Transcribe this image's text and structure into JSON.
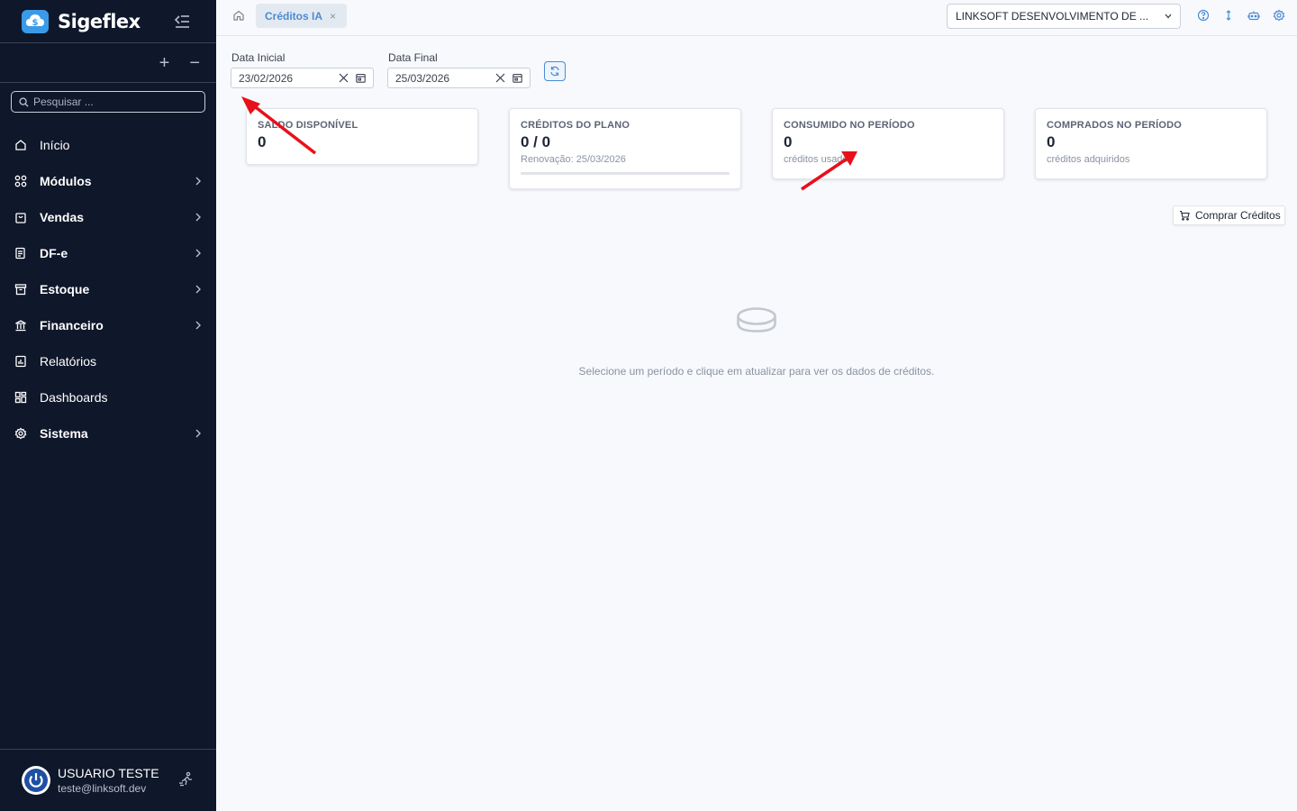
{
  "app": {
    "brand": "Sigeflex"
  },
  "sidebar": {
    "search_placeholder": "Pesquisar ...",
    "items": [
      {
        "label": "Início",
        "icon": "home-icon",
        "bold": false,
        "chevron": false
      },
      {
        "label": "Módulos",
        "icon": "grid-icon",
        "bold": true,
        "chevron": true
      },
      {
        "label": "Vendas",
        "icon": "shopping-bag-icon",
        "bold": true,
        "chevron": true
      },
      {
        "label": "DF-e",
        "icon": "document-icon",
        "bold": true,
        "chevron": true
      },
      {
        "label": "Estoque",
        "icon": "archive-box-icon",
        "bold": true,
        "chevron": true
      },
      {
        "label": "Financeiro",
        "icon": "bank-icon",
        "bold": true,
        "chevron": true
      },
      {
        "label": "Relatórios",
        "icon": "report-icon",
        "bold": false,
        "chevron": false
      },
      {
        "label": "Dashboards",
        "icon": "dashboard-icon",
        "bold": false,
        "chevron": false
      },
      {
        "label": "Sistema",
        "icon": "gear-icon",
        "bold": true,
        "chevron": true
      }
    ],
    "user": {
      "name": "USUARIO TESTE",
      "email": "teste@linksoft.dev"
    }
  },
  "topbar": {
    "tab_label": "Créditos IA",
    "tab_close": "×",
    "company": "LINKSOFT DESENVOLVIMENTO DE ..."
  },
  "filters": {
    "start_label": "Data Inicial",
    "start_value": "23/02/2026",
    "end_label": "Data Final",
    "end_value": "25/03/2026"
  },
  "cards": [
    {
      "title": "SALDO DISPONÍVEL",
      "value": "0",
      "sub": ""
    },
    {
      "title": "CRÉDITOS DO PLANO",
      "value": "0 / 0",
      "sub": "Renovação: 25/03/2026",
      "progress": 0
    },
    {
      "title": "CONSUMIDO NO PERÍODO",
      "value": "0",
      "sub": "créditos usados"
    },
    {
      "title": "COMPRADOS NO PERÍODO",
      "value": "0",
      "sub": "créditos adquiridos"
    }
  ],
  "buy_button": "Comprar Créditos",
  "empty_message": "Selecione um período e clique em atualizar para ver os dados de créditos.",
  "colors": {
    "sidebar_bg": "#0f172a",
    "accent": "#4a8bd4",
    "annotation_arrow": "#e8101a"
  }
}
